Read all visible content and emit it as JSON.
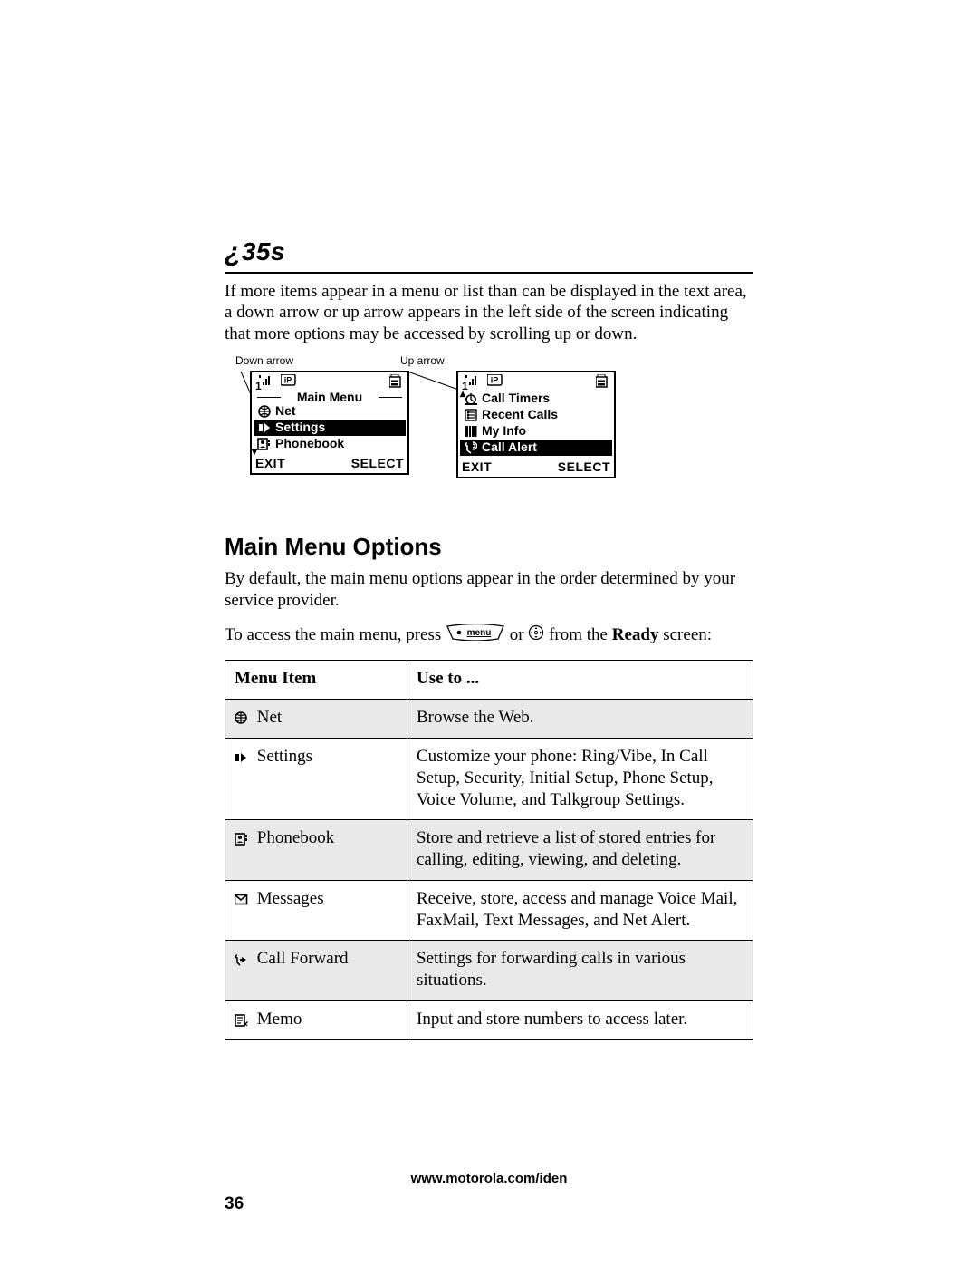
{
  "model": "35s",
  "intro": "If more items appear in a menu or list than can be displayed in the text area, a down arrow or up arrow appears in the left side of the screen indicating that more options may be accessed by scrolling up or down.",
  "callout_down": "Down arrow",
  "callout_up": "Up arrow",
  "screen_left": {
    "status_num": "1",
    "title": "Main Menu",
    "items": [
      {
        "label": "Net",
        "icon": "net",
        "selected": false
      },
      {
        "label": "Settings",
        "icon": "settings",
        "selected": true
      },
      {
        "label": "Phonebook",
        "icon": "phonebook",
        "selected": false
      }
    ],
    "soft_left": "EXIT",
    "soft_right": "SELECT"
  },
  "screen_right": {
    "status_num": "1",
    "items": [
      {
        "label": "Call Timers",
        "icon": "timers",
        "selected": false
      },
      {
        "label": "Recent Calls",
        "icon": "recent",
        "selected": false
      },
      {
        "label": "My Info",
        "icon": "myinfo",
        "selected": false
      },
      {
        "label": "Call Alert",
        "icon": "alert",
        "selected": true
      }
    ],
    "soft_left": "EXIT",
    "soft_right": "SELECT"
  },
  "section_title": "Main Menu Options",
  "section_p1": "By default, the main menu options appear in the order determined by your service provider.",
  "section_p2a": "To access the main menu, press ",
  "menu_key_label": "menu",
  "section_p2b": " or ",
  "section_p2c": " from the ",
  "ready_word": "Ready",
  "section_p2d": " screen:",
  "table": {
    "head_item": "Menu Item",
    "head_use": "Use to ...",
    "rows": [
      {
        "icon": "net",
        "name": "Net",
        "use": "Browse the Web."
      },
      {
        "icon": "settings",
        "name": "Settings",
        "use": "Customize your phone: Ring/Vibe, In Call Setup, Security, Initial Setup, Phone Setup, Voice Volume, and Talkgroup Settings."
      },
      {
        "icon": "phonebook",
        "name": "Phonebook",
        "use": "Store and retrieve a list of stored entries for calling, editing, viewing, and deleting."
      },
      {
        "icon": "messages",
        "name": "Messages",
        "use": "Receive, store, access and manage Voice Mail, FaxMail, Text Messages, and Net Alert."
      },
      {
        "icon": "forward",
        "name": "Call Forward",
        "use": "Settings for forwarding calls in various situations."
      },
      {
        "icon": "memo",
        "name": "Memo",
        "use": "Input and store numbers to access later."
      }
    ]
  },
  "footer": "www.motorola.com/iden",
  "page_number": "36"
}
